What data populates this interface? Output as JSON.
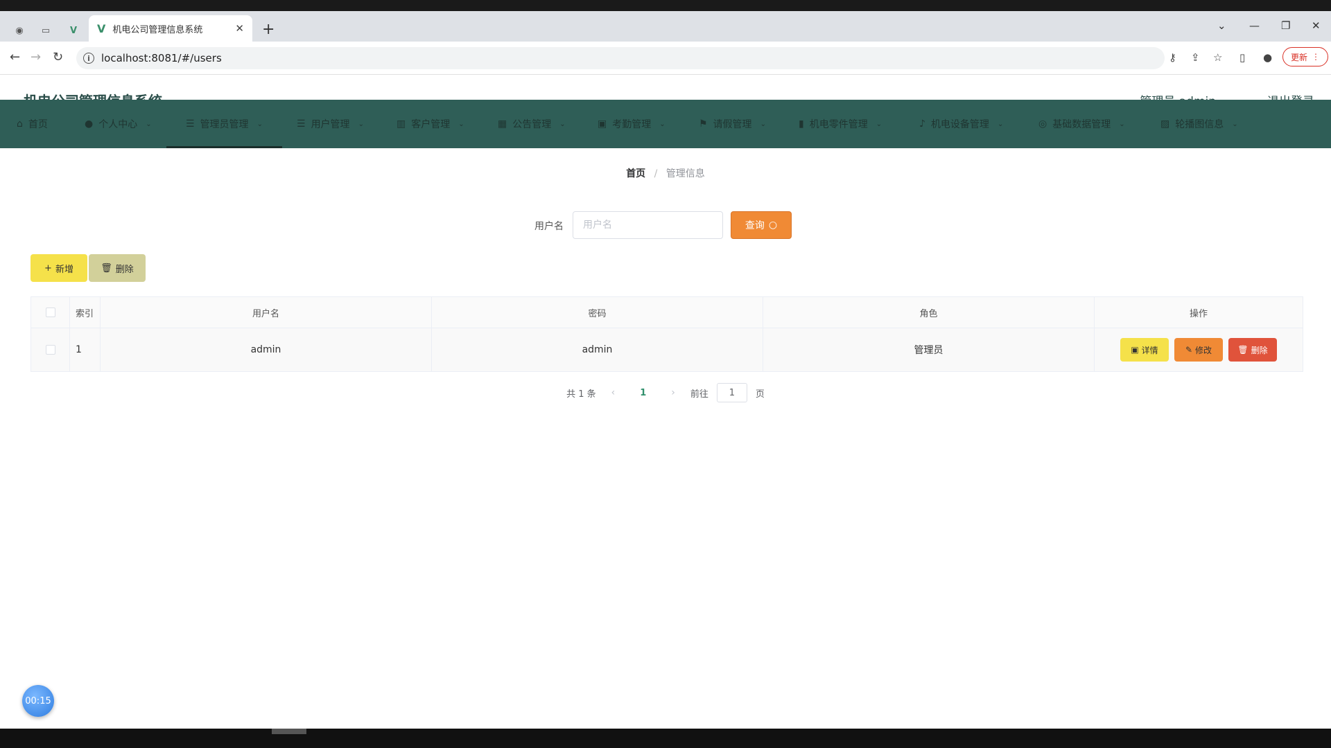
{
  "browser": {
    "tab_title": "机电公司管理信息系统",
    "url": "localhost:8081/#/users",
    "update_label": "更新"
  },
  "header": {
    "brand": "机电公司管理信息系统",
    "user_info": "管理员 admin",
    "logout": "退出登录"
  },
  "menu": {
    "items": [
      {
        "label": "首页",
        "icon": "home-icon"
      },
      {
        "label": "个人中心",
        "icon": "user-icon"
      },
      {
        "label": "管理员管理",
        "icon": "sliders-icon",
        "active": true
      },
      {
        "label": "用户管理",
        "icon": "list-icon"
      },
      {
        "label": "客户管理",
        "icon": "bar-chart-icon"
      },
      {
        "label": "公告管理",
        "icon": "grid-icon"
      },
      {
        "label": "考勤管理",
        "icon": "briefcase-icon"
      },
      {
        "label": "请假管理",
        "icon": "flag-icon"
      },
      {
        "label": "机电零件管理",
        "icon": "columns-icon"
      },
      {
        "label": "机电设备管理",
        "icon": "microphone-icon"
      },
      {
        "label": "基础数据管理",
        "icon": "circle-settings-icon"
      },
      {
        "label": "轮播图信息",
        "icon": "image-icon"
      }
    ]
  },
  "breadcrumb": {
    "home": "首页",
    "sep": "/",
    "current": "管理信息"
  },
  "search": {
    "label": "用户名",
    "placeholder": "用户名",
    "button": "查询"
  },
  "actions": {
    "add": "新增",
    "delete": "删除"
  },
  "table": {
    "headers": {
      "index": "索引",
      "username": "用户名",
      "password": "密码",
      "role": "角色",
      "operation": "操作"
    },
    "rows": [
      {
        "index": "1",
        "username": "admin",
        "password": "admin",
        "role": "管理员"
      }
    ],
    "row_buttons": {
      "detail": "详情",
      "edit": "修改",
      "delete": "删除"
    }
  },
  "pagination": {
    "total": "共 1 条",
    "current_page": "1",
    "goto_label": "前往",
    "goto_value": "1",
    "page_suffix": "页"
  },
  "timer": "00:15",
  "colors": {
    "menubar": "#2f5e57",
    "brand_text": "#2b4e4a",
    "search_button": "#f08a35",
    "add_button": "#f5e14a",
    "delete_row_button": "#e0533b"
  }
}
